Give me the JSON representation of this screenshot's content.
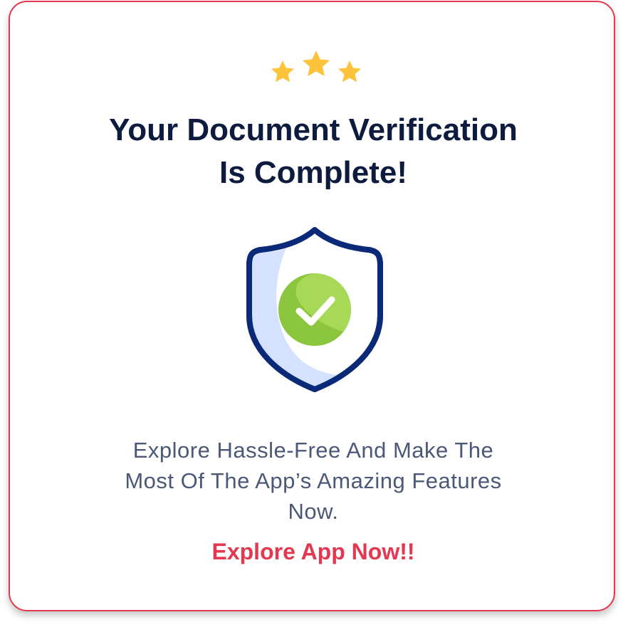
{
  "card": {
    "title_lines": [
      "Your Document Verification",
      "Is Complete!"
    ],
    "description_lines": [
      "Explore Hassle-Free And Make The",
      "Most Of The App’s Amazing Features",
      "Now."
    ],
    "cta_label": "Explore App Now!!",
    "icons": {
      "rating": "three-stars-icon",
      "badge": "verified-shield-icon",
      "check": "checkmark-icon"
    }
  },
  "colors": {
    "border": "#e3384f",
    "title": "#0d1b3e",
    "description": "#4b5877",
    "cta": "#e3384f",
    "star": "#fdc43b",
    "shield_outline": "#0a2a78",
    "shield_fill": "#d4e2ff",
    "check_circle": "#8cc63f"
  }
}
